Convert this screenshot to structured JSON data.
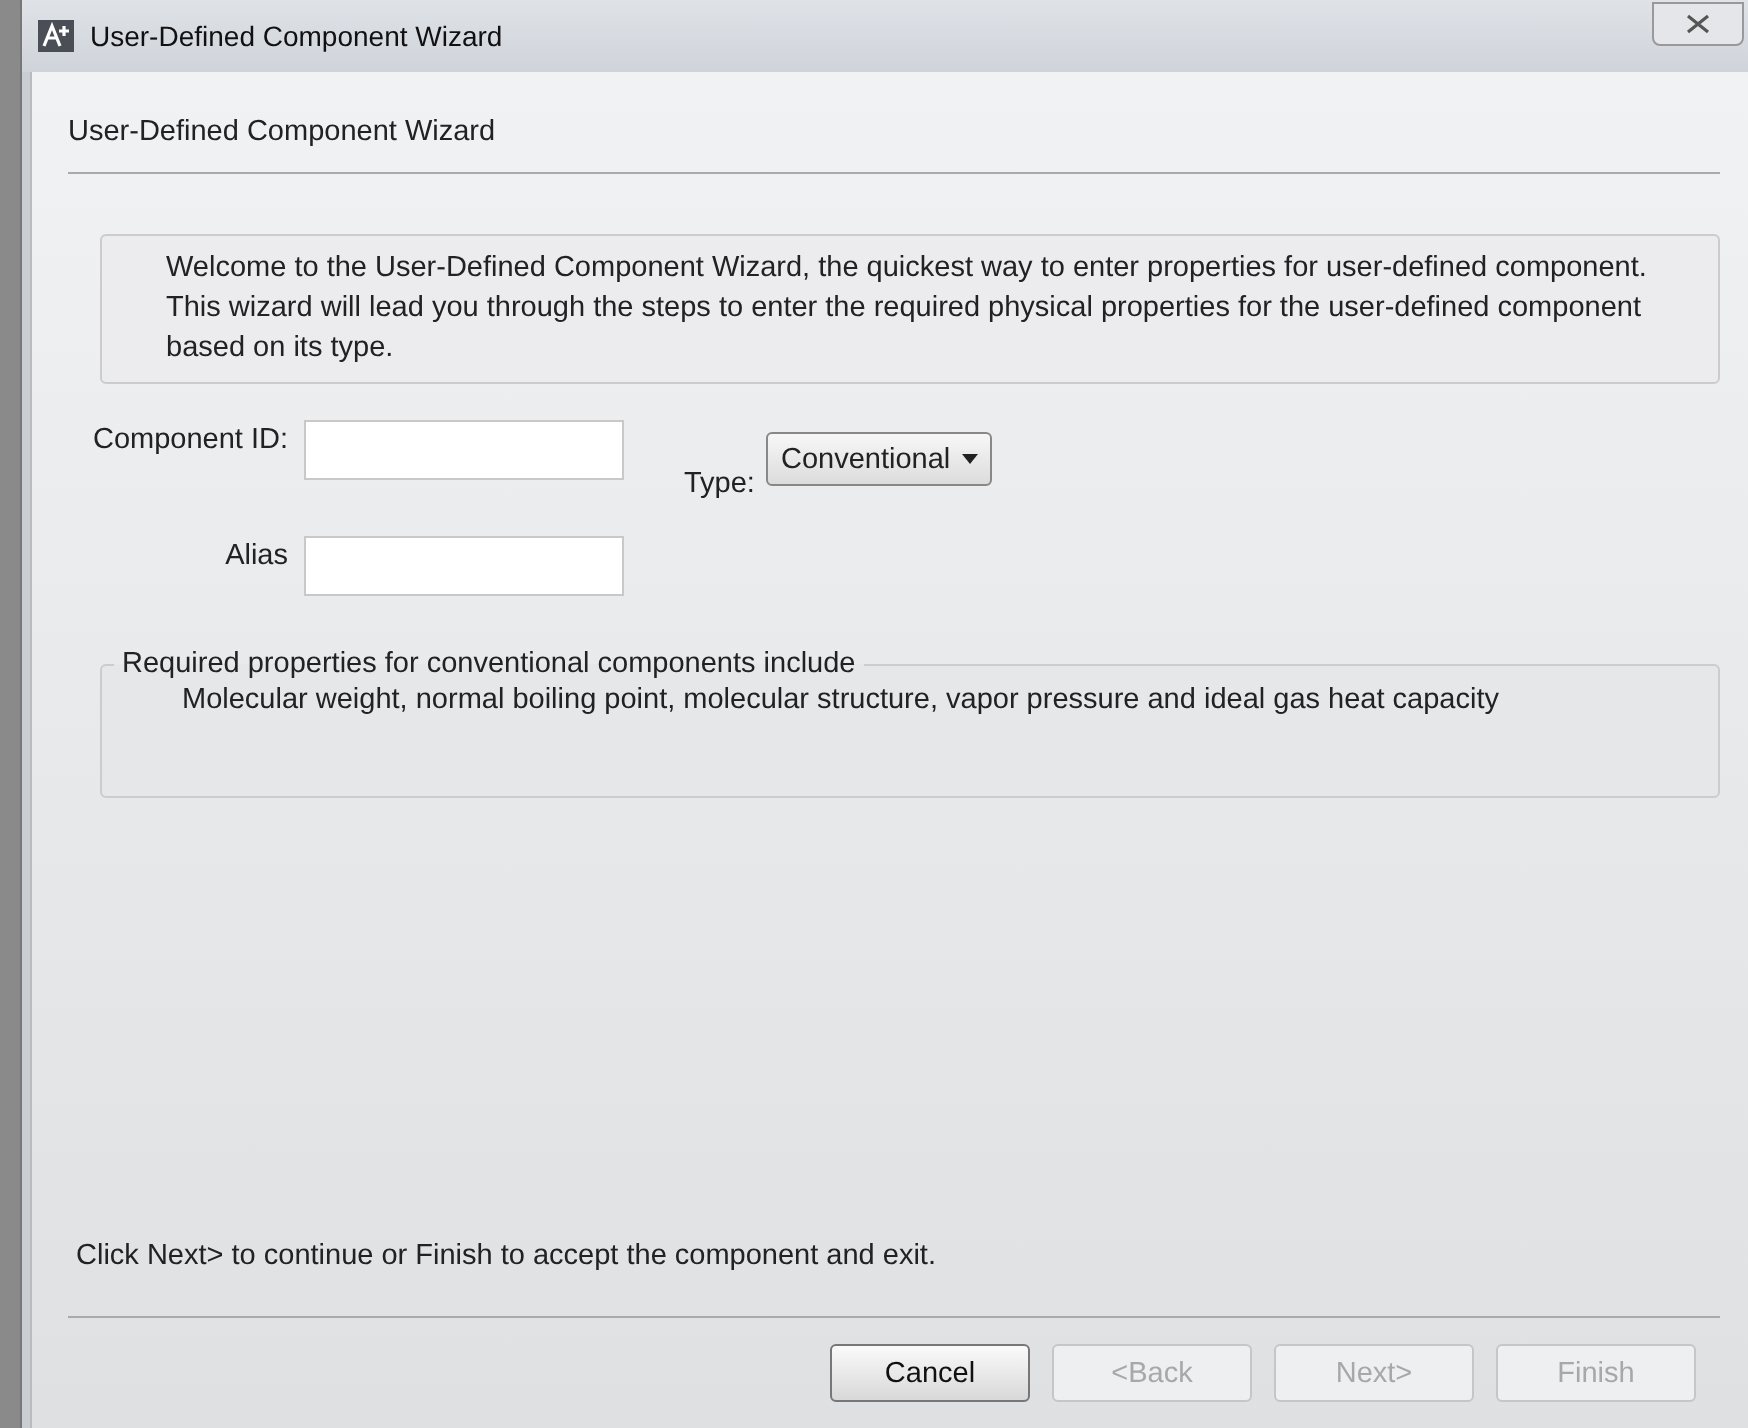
{
  "window": {
    "title": "User-Defined Component Wizard"
  },
  "header": "User-Defined Component Wizard",
  "intro": "Welcome to the User-Defined Component Wizard, the quickest way to enter properties for user-defined component.  This wizard will lead you through the steps to enter the required physical properties for the user-defined component based on its type.",
  "fields": [
    {
      "label": "Component ID:"
    },
    {
      "label": "Alias"
    }
  ],
  "type": {
    "label": "Type:",
    "value": "Conventional"
  },
  "group": {
    "title": "Required properties for conventional components include",
    "text": "Molecular weight, normal boiling point, molecular structure, vapor pressure and ideal gas heat capacity"
  },
  "footer_hint": "Click Next> to continue or Finish to accept the component and exit.",
  "buttons": [
    {
      "label": "Cancel",
      "disabled": false
    },
    {
      "label": "<Back",
      "disabled": true
    },
    {
      "label": "Next>",
      "disabled": true
    },
    {
      "label": "Finish",
      "disabled": true
    }
  ]
}
